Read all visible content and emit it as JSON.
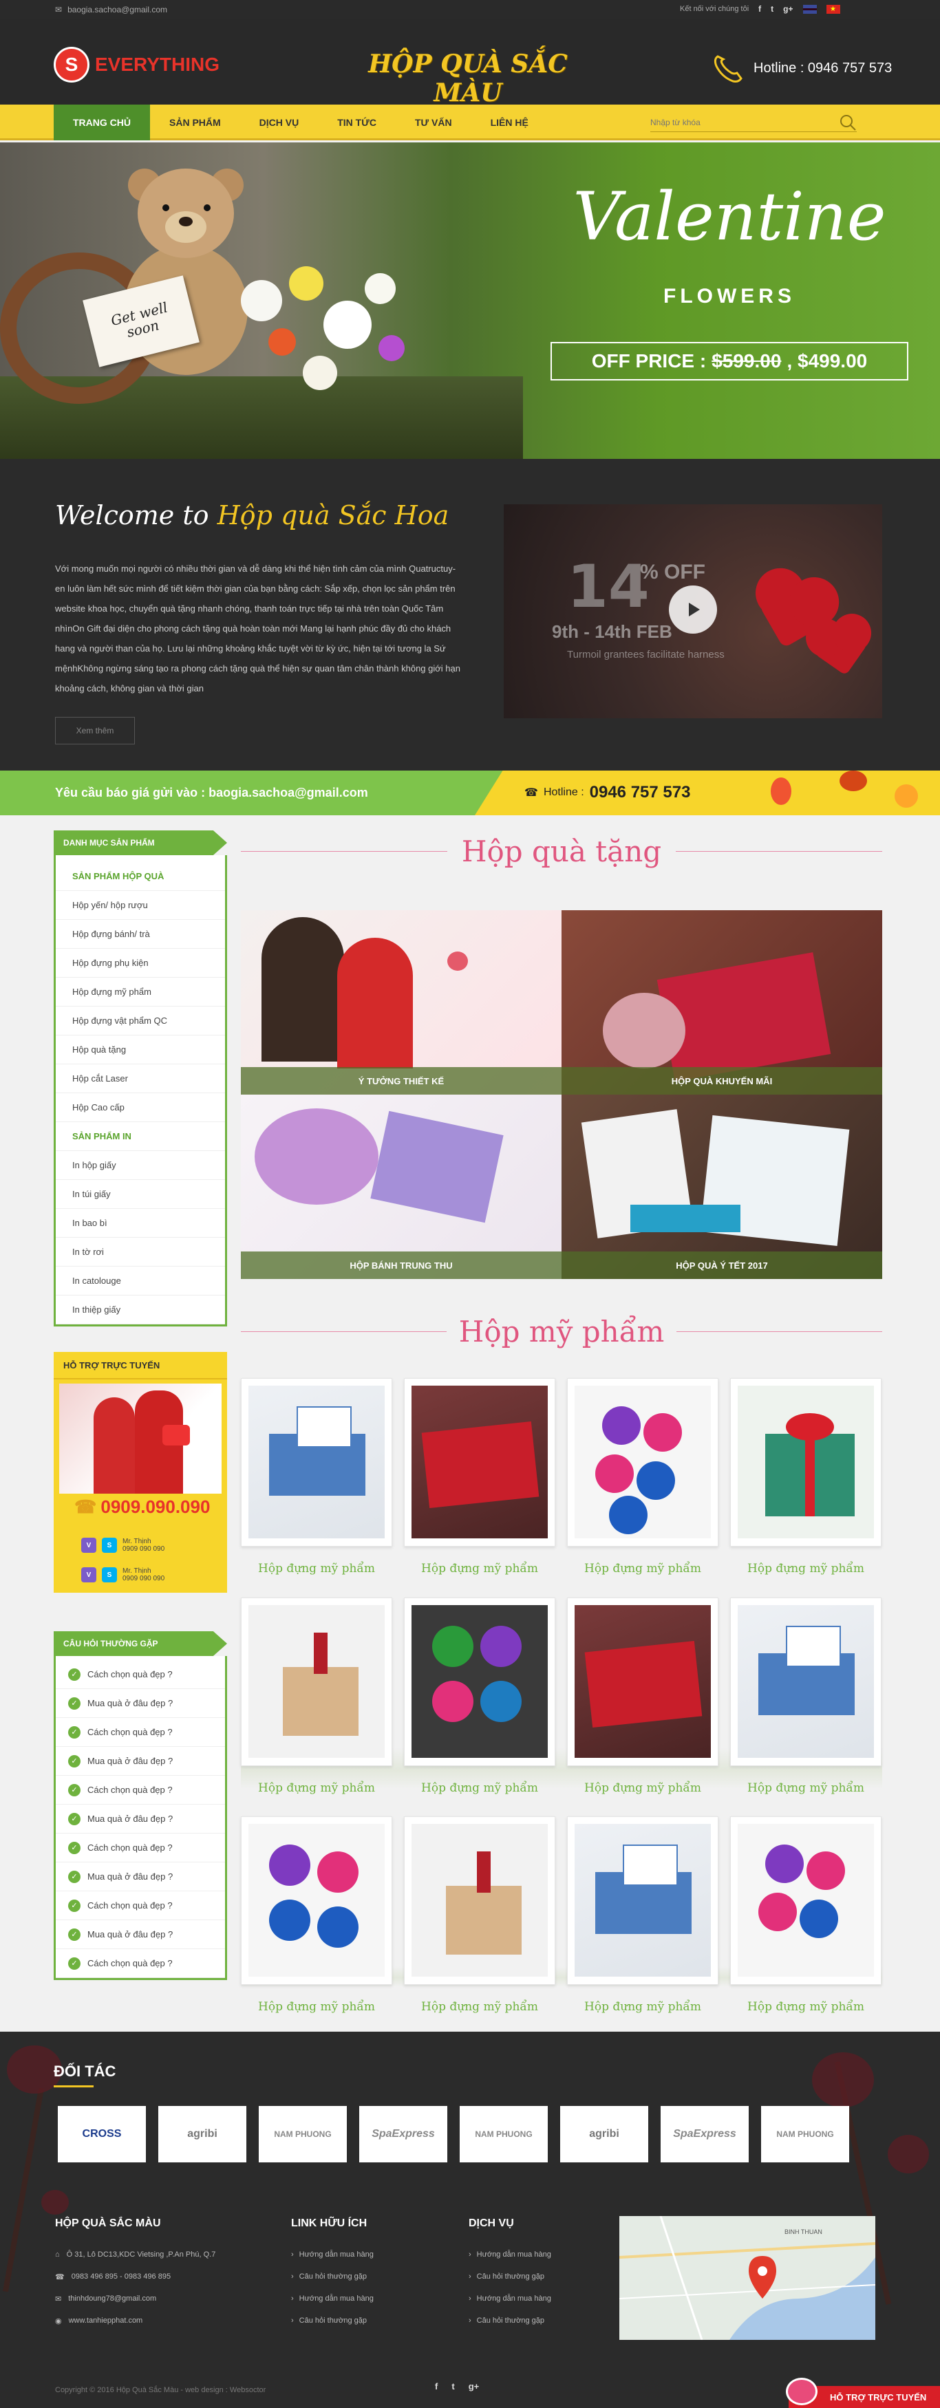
{
  "topbar": {
    "email": "baogia.sachoa@gmail.com",
    "connect_label": "Kết nối với chúng tôi",
    "social": [
      "f",
      "t",
      "g+"
    ]
  },
  "header": {
    "logo_letter": "S",
    "logo_text": "EVERYTHING",
    "brand": "HỘP QUÀ SẮC MÀU",
    "hotline": "Hotline : 0946 757 573"
  },
  "nav": {
    "items": [
      "TRANG CHỦ",
      "SẢN PHẨM",
      "DỊCH VỤ",
      "TIN TỨC",
      "TƯ VẤN",
      "LIÊN HỆ"
    ],
    "search_placeholder": "Nhập từ khóa"
  },
  "hero": {
    "sign_line1": "Get well",
    "sign_line2": "soon",
    "title": "Valentine",
    "subtitle": "FLOWERS",
    "price_label": "OFF PRICE :",
    "old_price": "$599.00",
    "new_price": ", $499.00"
  },
  "welcome": {
    "title_prefix": "Welcome to",
    "title_highlight": "Hộp quà Sắc Hoa",
    "text": "Với mong muốn mọi người có nhiều thời gian và dễ dàng khi thể hiện tình cảm của mình Quatructuy-en luôn làm hết sức mình để tiết kiệm thời gian của bạn bằng cách: Sắp xếp, chọn lọc sản phẩm trên website khoa học, chuyển quà tặng nhanh chóng, thanh toán trực tiếp tại nhà trên toàn Quốc Tâm nhìnOn Gift đại diện cho phong cách tặng quà hoàn toàn mới Mang lại hạnh phúc đầy đủ cho khách hang và người than của họ. Lưu lại những khoảng khắc tuyệt vời từ kỳ ức, hiện tại tới tương la Sứ mệnhKhông ngừng sáng tạo ra phong cách tặng quà thể hiện sự quan tâm chân thành không giới hạn khoảng cách, không gian và thời gian",
    "more_button": "Xem thêm",
    "video": {
      "big": "14",
      "off": "% OFF",
      "dates": "9th - 14th FEB",
      "tagline": "Turmoil grantees facilitate harness"
    }
  },
  "quote_bar": {
    "text": "Yêu cầu báo giá  gửi  vào : baogia.sachoa@gmail.com",
    "hotline_label": "Hotline :",
    "hotline_number": "0946 757 573"
  },
  "sidebar": {
    "title": "DANH MỤC SẢN PHẨM",
    "cat1": "SẢN PHẨM HỘP QUÀ",
    "cat1_items": [
      "Hộp yến/ hộp rượu",
      "Hộp đựng bánh/ trà",
      "Hộp đựng phụ kiện",
      "Hộp đựng mỹ phẩm",
      "Hộp đựng vật phẩm QC",
      "Hộp quà tặng",
      "Hộp cắt Laser",
      "Hộp Cao cấp"
    ],
    "cat2": "SẢN PHẨM IN",
    "cat2_items": [
      "In hộp giấy",
      "In túi giấy",
      "In bao bì",
      "In tờ rơi",
      "In catolouge",
      "In thiệp giấy"
    ]
  },
  "support": {
    "title": "HỖ TRỢ TRỰC TUYẾN",
    "phone": "0909.090.090",
    "contacts": [
      {
        "name": "Mr. Thịnh",
        "phone": "0909 090 090"
      },
      {
        "name": "Mr. Thịnh",
        "phone": "0909 090 090"
      }
    ]
  },
  "faq": {
    "title": "CÂU HỎI THƯỜNG GẶP",
    "items": [
      "Cách chọn quà đẹp ?",
      "Mua quà ở đâu đẹp ?",
      "Cách chọn quà đẹp ?",
      "Mua quà ở đâu đẹp ?",
      "Cách chọn quà đẹp ?",
      "Mua quà ở đâu đẹp ?",
      "Cách chọn quà đẹp ?",
      "Mua quà ở đâu đẹp ?",
      "Cách chọn quà đẹp ?",
      "Mua quà ở đâu đẹp ?",
      "Cách chọn quà đẹp ?"
    ]
  },
  "gifts": {
    "title": "Hộp quà tặng",
    "tiles": [
      "Ý TƯỞNG THIẾT KẾ",
      "HỘP QUÀ KHUYẾN MÃI",
      "HỘP BÁNH TRUNG THU",
      "HỘP QUÀ Ý TẾT 2017"
    ]
  },
  "cosmetics": {
    "title": "Hộp mỹ phẩm",
    "product_name": "Hộp đựng mỹ phẩm"
  },
  "footer": {
    "partners_title": "ĐỐI TÁC",
    "partners": [
      "CROSS",
      "agribi",
      "NAM PHUONG",
      "SpaExpress",
      "NAM PHUONG",
      "agribi",
      "SpaExpress",
      "NAM PHUONG"
    ],
    "col1_title": "HỘP QUÀ SẮC MÀU",
    "address": "Ô 31, Lô DC13,KDC Vietsing ,P.An Phú, Q.7",
    "phones": "0983 496 895 - 0983 496 895",
    "email": "thinhdoung78@gmail.com",
    "website": "www.tanhiepphat.com",
    "col2_title": "LINK HỮU ÍCH",
    "col2_links": [
      "Hướng dẫn mua hàng",
      "Câu hỏi thường gặp",
      "Hướng dẫn mua hàng",
      "Câu hỏi thường gặp"
    ],
    "col3_title": "DỊCH VỤ",
    "col3_links": [
      "Hướng dẫn mua hàng",
      "Câu hỏi thường gặp",
      "Hướng dẫn mua hàng",
      "Câu hỏi thường gặp"
    ],
    "copyright": "Copyright © 2016 Hộp Quà Sắc Màu - web design : Websoctor",
    "social": [
      "f",
      "t",
      "g+"
    ],
    "chat": "HỖ TRỢ TRỰC TUYẾN",
    "map_label": "BINH THUAN"
  }
}
